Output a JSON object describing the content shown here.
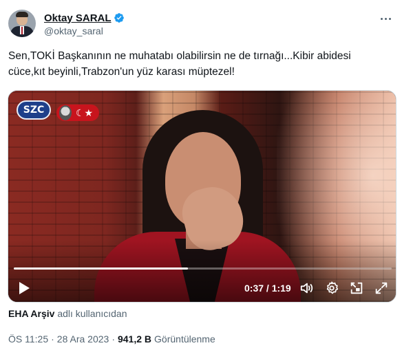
{
  "author": {
    "name": "Oktay SARAL",
    "handle": "@oktay_saral",
    "verified": true,
    "accent": "#1d9bf0"
  },
  "tweet": {
    "text_line1": "Sen,TOKİ Başkanının ne muhatabı olabilirsin ne de tırnağı...Kibir abidesi",
    "text_line2": "cüce,kıt beyinli,Trabzon'un yüz karası müptezel!"
  },
  "video": {
    "channel_logo": "SZC",
    "time_current": "0:37",
    "time_total": "1:19",
    "time_display": "0:37 / 1:19",
    "progress": 0.46,
    "icons": [
      "play-icon",
      "volume-icon",
      "settings-icon",
      "pip-icon",
      "fullscreen-icon"
    ]
  },
  "source": {
    "account": "EHA Arşiv",
    "suffix": "adlı kullanıcıdan"
  },
  "meta": {
    "time": "ÖS 11:25",
    "sep1": "·",
    "date": "28 Ara 2023",
    "sep2": "·",
    "views_count": "941,2 B",
    "views_label": "Görüntülenme"
  }
}
